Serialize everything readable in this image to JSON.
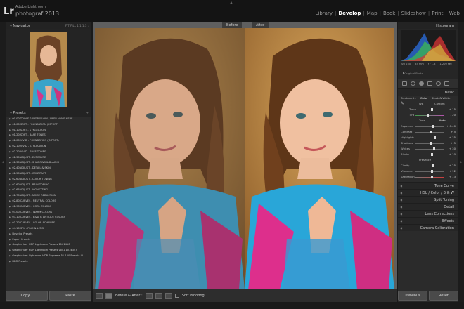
{
  "app": {
    "logo": "Lr",
    "brand_line1": "Adobe Lightroom",
    "brand_line2": "photograf 2013"
  },
  "modules": [
    "Library",
    "Develop",
    "Map",
    "Book",
    "Slideshow",
    "Print",
    "Web"
  ],
  "active_module": "Develop",
  "navigator": {
    "title": "Navigator",
    "zoom_options": "FIT   FILL   1:1   1:3 :"
  },
  "presets": {
    "title": "Presets",
    "items": [
      "00-00 TOOLS & WORKFLOW / USER NAME HERE",
      "01-00 SOFT - FOUNDATION (IMPORT)",
      "01-10 SOFT - STYLIZATION",
      "01-20 SOFT - BASE TONES",
      "02-00 VIVID - FOUNDATION (IMPORT)",
      "02-10 VIVID - STYLIZATION",
      "02-20 VIVID - BASE TONES",
      "02-30 ADJUST - EXPOSURE",
      "02-30 ADJUST - SHADOWS & BLACKS",
      "02-40 ADJUST - DETAIL & SKIN",
      "02-50 ADJUST - CONTRAST",
      "02-60 ADJUST - COLOR TONING",
      "02-60 ADJUST - B&W TONING",
      "02-65 ADJUST - VIGNETTING",
      "02-70 ADJUST - NOISE REDUCTION",
      "02-80 CURVES - NEUTRAL COLORS",
      "02-90 CURVES - COOL COLORS",
      "03-00 CURVES - WARM COLORS",
      "03-10 CURVES - B&W & ANTIQUE COLORS",
      "03-20 CURVES - COLOR SCHEMES",
      "04-10 SFX - FILM & LENS",
      "Develop Presets",
      "Export Presets",
      "Graphicriver HDR Lightroom Presets 1161410",
      "Graphicriver HDR Lightroom Presets Vol.1 1014347",
      "Graphicriver Lightroom HDR Supreme 51-100 Presets III...",
      "HDR Presets"
    ]
  },
  "left_buttons": {
    "copy": "Copy...",
    "paste": "Paste"
  },
  "view": {
    "before_label": "Before",
    "after_label": "After"
  },
  "toolbar": {
    "before_after": "Before & After :",
    "soft_proofing": "Soft Proofing"
  },
  "histogram": {
    "title": "Histogram",
    "iso": "ISO 250",
    "focal": "85 mm",
    "aperture": "f / 1.8",
    "shutter": "1/200 sec",
    "original_photo": "Original Photo"
  },
  "basic": {
    "title": "Basic",
    "treatment_label": "Treatment :",
    "treatment_color": "Color",
    "treatment_bw": "Black & White",
    "wb_label": "WB :",
    "wb_value": "Custom :",
    "temp_label": "Temp",
    "temp_value": "+ 15",
    "tint_label": "Tint",
    "tint_value": "- 20",
    "tone_label": "Tone",
    "tone_auto": "Auto",
    "exposure_label": "Exposure",
    "exposure_value": "+ 0.40",
    "contrast_label": "Contrast",
    "contrast_value": "+ 5",
    "highlights_label": "Highlights",
    "highlights_value": "+ 35",
    "shadows_label": "Shadows",
    "shadows_value": "+ 5",
    "whites_label": "Whites",
    "whites_value": "+ 30",
    "blacks_label": "Blacks",
    "blacks_value": "+ 10",
    "presence_label": "Presence",
    "clarity_label": "Clarity",
    "clarity_value": "+ 25",
    "vibrance_label": "Vibrance",
    "vibrance_value": "+ 12",
    "saturation_label": "Saturation",
    "saturation_value": "+ 13"
  },
  "sections": {
    "tone_curve": "Tone Curve",
    "hsl": "HSL  /  Color  /  B & W",
    "split_toning": "Split Toning",
    "detail": "Detail",
    "lens_corrections": "Lens Corrections",
    "effects": "Effects",
    "camera_calibration": "Camera Calibration"
  },
  "right_buttons": {
    "previous": "Previous",
    "reset": "Reset"
  },
  "colors": {
    "bg": "#1a1a1a",
    "panel": "#2b2b2b",
    "center_bg": "#5f5f5f",
    "active_text": "#ffffff"
  }
}
